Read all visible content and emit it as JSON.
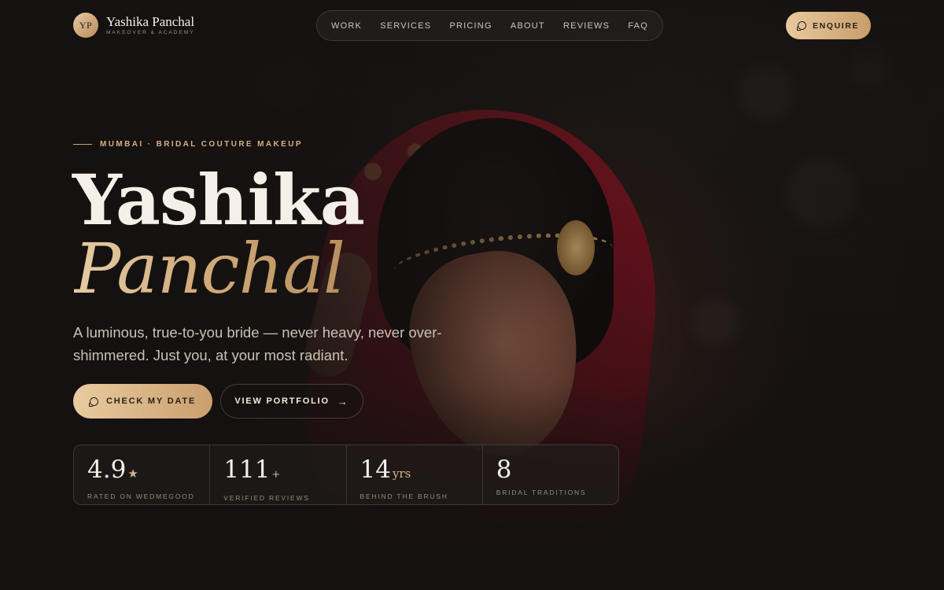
{
  "brand": {
    "monogram": "YP",
    "name": "Yashika Panchal",
    "tagline": "MAKEOVER & ACADEMY"
  },
  "nav": {
    "items": [
      "WORK",
      "SERVICES",
      "PRICING",
      "ABOUT",
      "REVIEWS",
      "FAQ"
    ]
  },
  "header": {
    "enquire_label": "ENQUIRE",
    "enquire_icon": "whatsapp-icon"
  },
  "hero": {
    "kicker": "MUMBAI · BRIDAL COUTURE MAKEUP",
    "title_line1": "Yashika",
    "title_line2": "Panchal",
    "lede": "A luminous, true-to-you bride — never heavy, never over-shimmered. Just you, at your most radiant.",
    "cta_primary": "CHECK MY DATE",
    "cta_primary_icon": "whatsapp-icon",
    "cta_secondary": "VIEW PORTFOLIO",
    "cta_secondary_icon": "arrow-right-icon"
  },
  "stats": [
    {
      "value": "4.9",
      "suffix": "★",
      "label": "RATED ON WEDMEGOOD"
    },
    {
      "value": "111",
      "suffix": "+",
      "label": "VERIFIED REVIEWS"
    },
    {
      "value": "14",
      "suffix": "yrs",
      "label": "BEHIND THE BRUSH"
    },
    {
      "value": "8",
      "suffix": "",
      "label": "BRIDAL TRADITIONS"
    }
  ],
  "colors": {
    "background": "#141110",
    "accent_gold": "#d3b183",
    "button_gold_start": "#e9cba0",
    "button_gold_end": "#c99f6d",
    "veil_red": "#8e1724"
  }
}
